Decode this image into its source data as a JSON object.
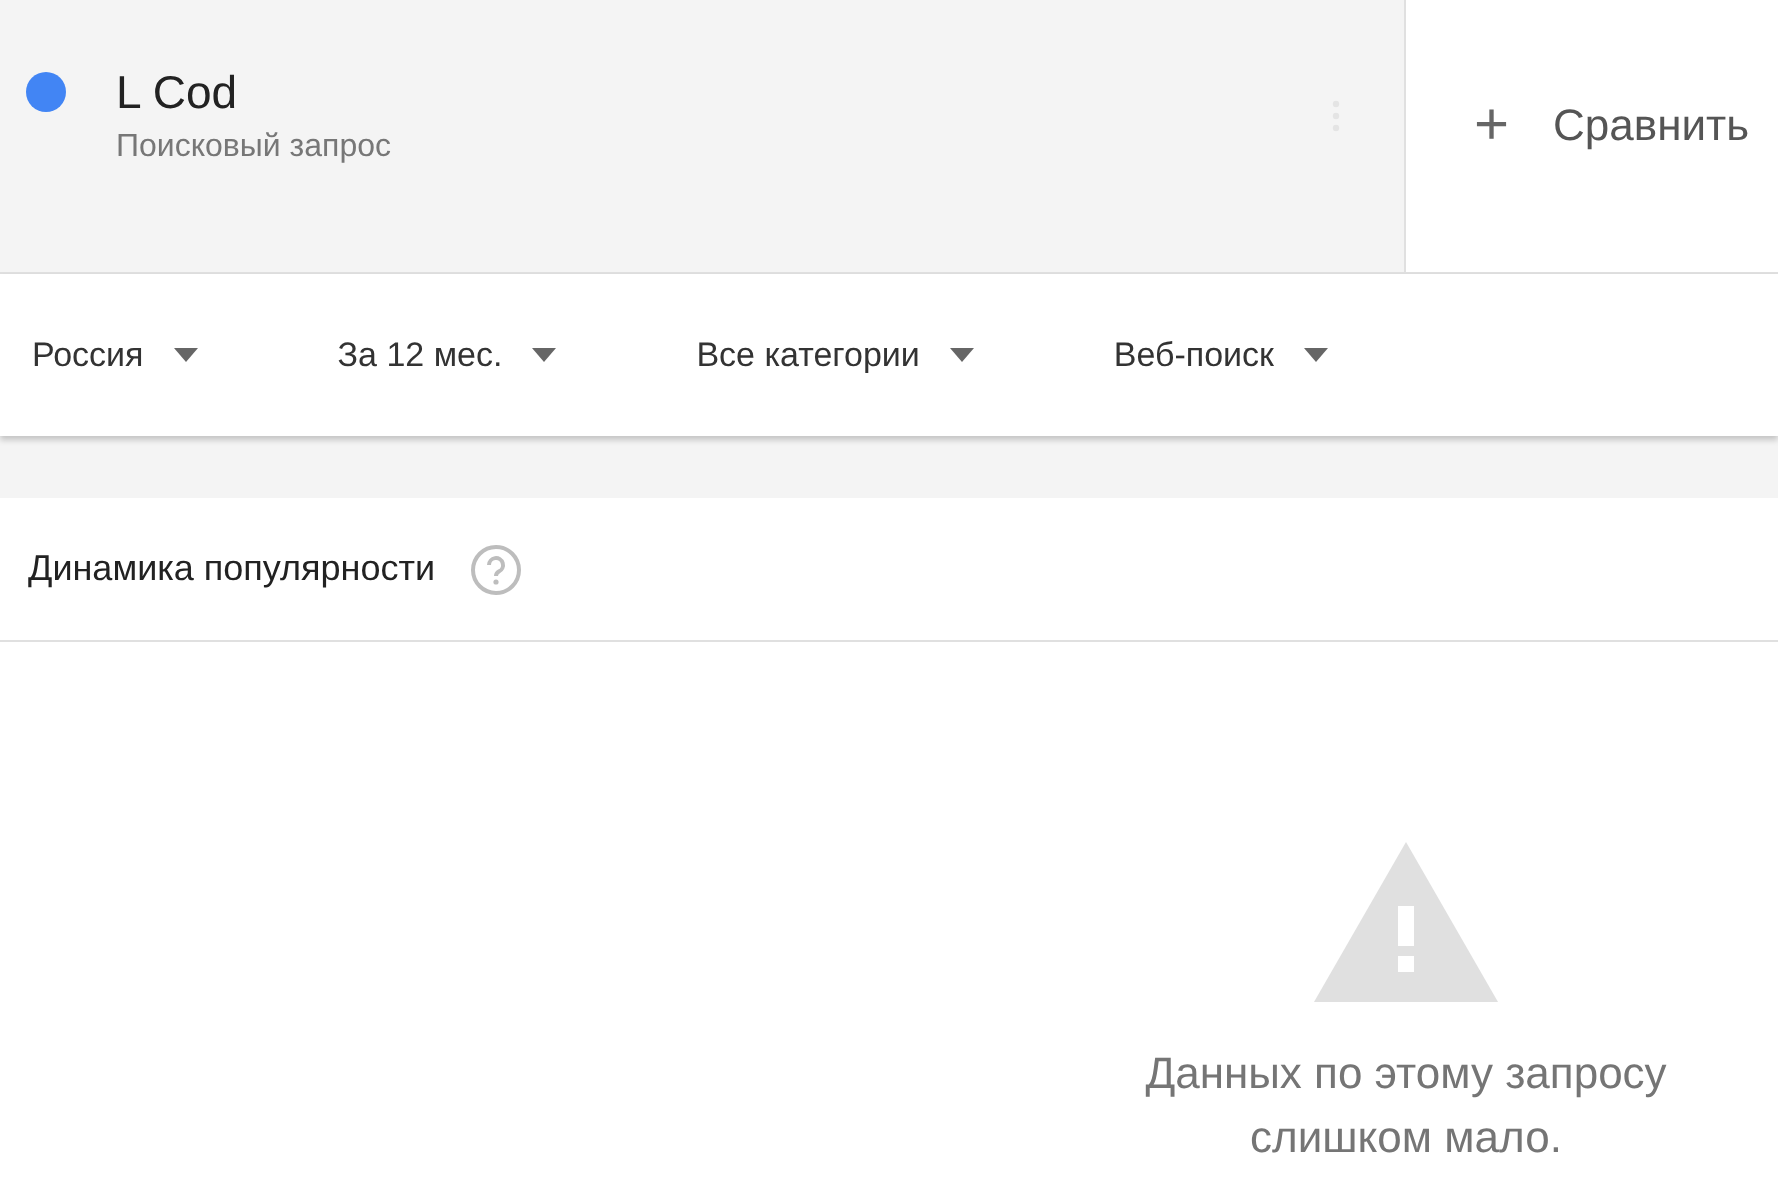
{
  "term": {
    "name": "L Cod",
    "type": "Поисковый запрос",
    "color": "#4285f4"
  },
  "compare": {
    "icon": "+",
    "label": "Сравнить"
  },
  "filters": [
    {
      "label": "Россия"
    },
    {
      "label": "За 12 мес."
    },
    {
      "label": "Все категории"
    },
    {
      "label": "Веб-поиск"
    }
  ],
  "card": {
    "title": "Динамика популярности",
    "message": "Данных по этому запросу слишком мало."
  }
}
